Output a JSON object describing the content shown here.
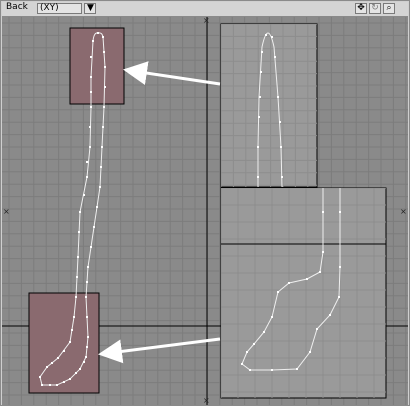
{
  "toolbar": {
    "view_label": "Back",
    "axis_label": "(XY)",
    "axis_dropdown_icon": "chevron-down-icon",
    "dropdown_glyph": "▼",
    "move_icon": "move-icon",
    "move_glyph": "✥",
    "rotate_icon": "rotate-icon",
    "rotate_glyph": "↻",
    "zoom_icon": "magnifier-icon",
    "zoom_glyph": "⌕"
  },
  "viewport": {
    "axis_marker": "×"
  },
  "colors": {
    "background": "#8a8a8a",
    "grid": "#7c7c7c",
    "grid_major": "#6f6f6f",
    "axis": "#000000",
    "highlight_fill": "#8a6a6f",
    "inset_fill": "#9a9a9a",
    "curve": "#f0f0f0",
    "arrow": "#ffffff"
  }
}
